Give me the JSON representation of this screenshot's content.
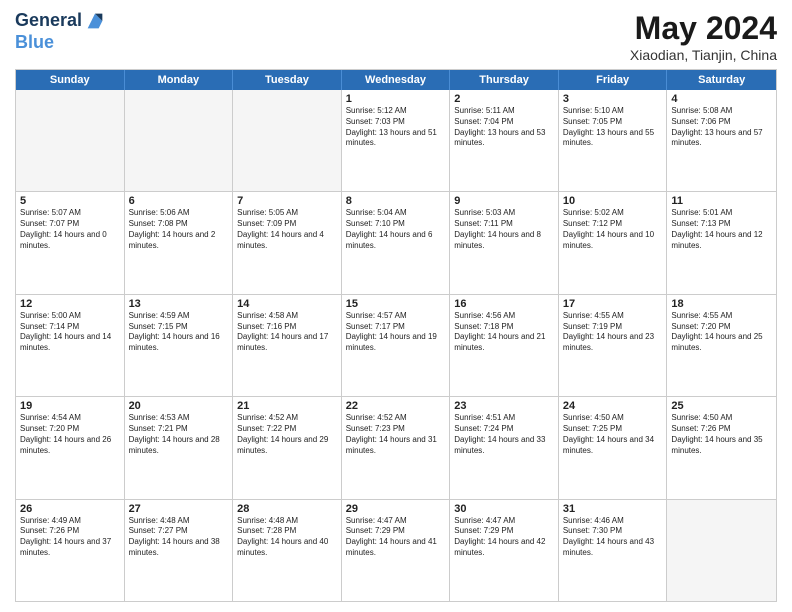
{
  "header": {
    "logo_line1": "General",
    "logo_line2": "Blue",
    "title": "May 2024",
    "subtitle": "Xiaodian, Tianjin, China"
  },
  "calendar": {
    "days_of_week": [
      "Sunday",
      "Monday",
      "Tuesday",
      "Wednesday",
      "Thursday",
      "Friday",
      "Saturday"
    ],
    "weeks": [
      [
        {
          "day": "",
          "empty": true
        },
        {
          "day": "",
          "empty": true
        },
        {
          "day": "",
          "empty": true
        },
        {
          "day": "1",
          "sunrise": "5:12 AM",
          "sunset": "7:03 PM",
          "daylight": "13 hours and 51 minutes."
        },
        {
          "day": "2",
          "sunrise": "5:11 AM",
          "sunset": "7:04 PM",
          "daylight": "13 hours and 53 minutes."
        },
        {
          "day": "3",
          "sunrise": "5:10 AM",
          "sunset": "7:05 PM",
          "daylight": "13 hours and 55 minutes."
        },
        {
          "day": "4",
          "sunrise": "5:08 AM",
          "sunset": "7:06 PM",
          "daylight": "13 hours and 57 minutes."
        }
      ],
      [
        {
          "day": "5",
          "sunrise": "5:07 AM",
          "sunset": "7:07 PM",
          "daylight": "14 hours and 0 minutes."
        },
        {
          "day": "6",
          "sunrise": "5:06 AM",
          "sunset": "7:08 PM",
          "daylight": "14 hours and 2 minutes."
        },
        {
          "day": "7",
          "sunrise": "5:05 AM",
          "sunset": "7:09 PM",
          "daylight": "14 hours and 4 minutes."
        },
        {
          "day": "8",
          "sunrise": "5:04 AM",
          "sunset": "7:10 PM",
          "daylight": "14 hours and 6 minutes."
        },
        {
          "day": "9",
          "sunrise": "5:03 AM",
          "sunset": "7:11 PM",
          "daylight": "14 hours and 8 minutes."
        },
        {
          "day": "10",
          "sunrise": "5:02 AM",
          "sunset": "7:12 PM",
          "daylight": "14 hours and 10 minutes."
        },
        {
          "day": "11",
          "sunrise": "5:01 AM",
          "sunset": "7:13 PM",
          "daylight": "14 hours and 12 minutes."
        }
      ],
      [
        {
          "day": "12",
          "sunrise": "5:00 AM",
          "sunset": "7:14 PM",
          "daylight": "14 hours and 14 minutes."
        },
        {
          "day": "13",
          "sunrise": "4:59 AM",
          "sunset": "7:15 PM",
          "daylight": "14 hours and 16 minutes."
        },
        {
          "day": "14",
          "sunrise": "4:58 AM",
          "sunset": "7:16 PM",
          "daylight": "14 hours and 17 minutes."
        },
        {
          "day": "15",
          "sunrise": "4:57 AM",
          "sunset": "7:17 PM",
          "daylight": "14 hours and 19 minutes."
        },
        {
          "day": "16",
          "sunrise": "4:56 AM",
          "sunset": "7:18 PM",
          "daylight": "14 hours and 21 minutes."
        },
        {
          "day": "17",
          "sunrise": "4:55 AM",
          "sunset": "7:19 PM",
          "daylight": "14 hours and 23 minutes."
        },
        {
          "day": "18",
          "sunrise": "4:55 AM",
          "sunset": "7:20 PM",
          "daylight": "14 hours and 25 minutes."
        }
      ],
      [
        {
          "day": "19",
          "sunrise": "4:54 AM",
          "sunset": "7:20 PM",
          "daylight": "14 hours and 26 minutes."
        },
        {
          "day": "20",
          "sunrise": "4:53 AM",
          "sunset": "7:21 PM",
          "daylight": "14 hours and 28 minutes."
        },
        {
          "day": "21",
          "sunrise": "4:52 AM",
          "sunset": "7:22 PM",
          "daylight": "14 hours and 29 minutes."
        },
        {
          "day": "22",
          "sunrise": "4:52 AM",
          "sunset": "7:23 PM",
          "daylight": "14 hours and 31 minutes."
        },
        {
          "day": "23",
          "sunrise": "4:51 AM",
          "sunset": "7:24 PM",
          "daylight": "14 hours and 33 minutes."
        },
        {
          "day": "24",
          "sunrise": "4:50 AM",
          "sunset": "7:25 PM",
          "daylight": "14 hours and 34 minutes."
        },
        {
          "day": "25",
          "sunrise": "4:50 AM",
          "sunset": "7:26 PM",
          "daylight": "14 hours and 35 minutes."
        }
      ],
      [
        {
          "day": "26",
          "sunrise": "4:49 AM",
          "sunset": "7:26 PM",
          "daylight": "14 hours and 37 minutes."
        },
        {
          "day": "27",
          "sunrise": "4:48 AM",
          "sunset": "7:27 PM",
          "daylight": "14 hours and 38 minutes."
        },
        {
          "day": "28",
          "sunrise": "4:48 AM",
          "sunset": "7:28 PM",
          "daylight": "14 hours and 40 minutes."
        },
        {
          "day": "29",
          "sunrise": "4:47 AM",
          "sunset": "7:29 PM",
          "daylight": "14 hours and 41 minutes."
        },
        {
          "day": "30",
          "sunrise": "4:47 AM",
          "sunset": "7:29 PM",
          "daylight": "14 hours and 42 minutes."
        },
        {
          "day": "31",
          "sunrise": "4:46 AM",
          "sunset": "7:30 PM",
          "daylight": "14 hours and 43 minutes."
        },
        {
          "day": "",
          "empty": true
        }
      ]
    ]
  }
}
